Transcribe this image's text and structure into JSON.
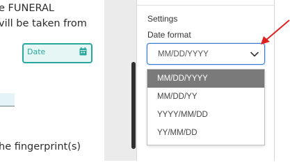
{
  "document": {
    "lines": [
      "e FUNERAL",
      "vill be taken from",
      "he fingerprint(s)"
    ],
    "date_field": {
      "label": "Date",
      "icon": "calendar-icon",
      "accent": "#2aa79b"
    }
  },
  "panel": {
    "section_title": "Settings",
    "field_label": "Date format",
    "select": {
      "value": "MM/DD/YYYY",
      "icon": "chevron-down-icon",
      "focus_color": "#3a7bd5"
    },
    "options": [
      "MM/DD/YYYY",
      "MM/DD/YY",
      "YYYY/MM/DD",
      "YY/MM/DD"
    ],
    "selected_option_color": "#7a7a7a"
  },
  "annotation": {
    "type": "arrow",
    "color": "#e02020"
  }
}
